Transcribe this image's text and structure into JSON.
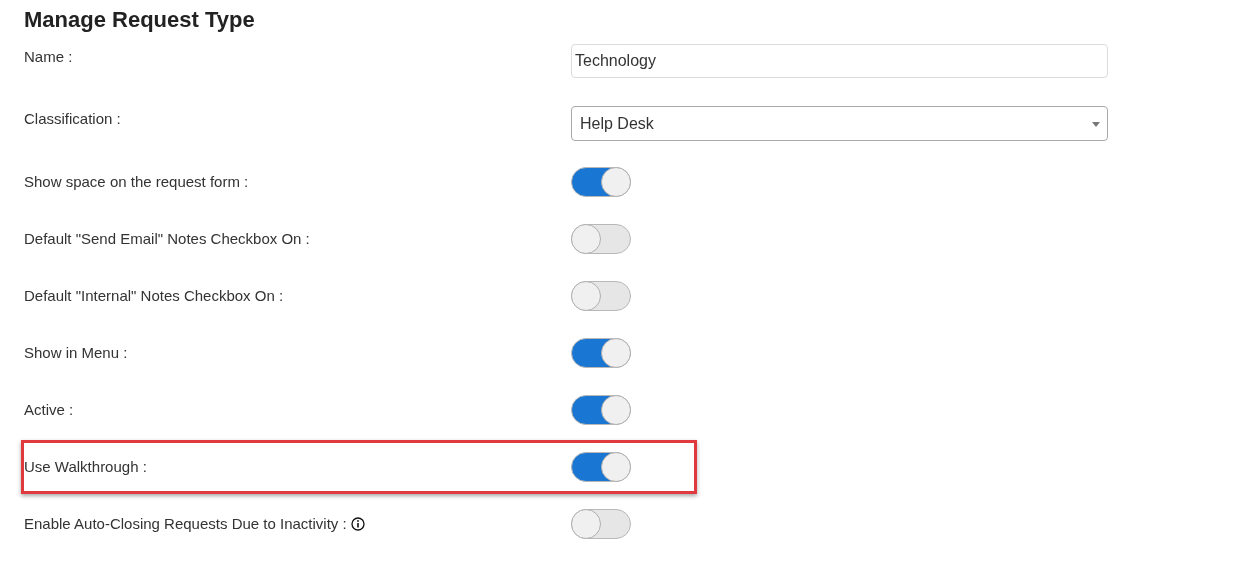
{
  "title": "Manage Request Type",
  "rows": [
    {
      "kind": "text",
      "label": "Name :",
      "value": "Technology"
    },
    {
      "kind": "select",
      "label": "Classification :",
      "value": "Help Desk"
    },
    {
      "kind": "toggle",
      "label": "Show space on the request form :",
      "on": true,
      "highlighted": false
    },
    {
      "kind": "toggle",
      "label": "Default \"Send Email\" Notes Checkbox On :",
      "on": false,
      "highlighted": false
    },
    {
      "kind": "toggle",
      "label": "Default \"Internal\" Notes Checkbox On :",
      "on": false,
      "highlighted": false
    },
    {
      "kind": "toggle",
      "label": "Show in Menu :",
      "on": true,
      "highlighted": false
    },
    {
      "kind": "toggle",
      "label": "Active :",
      "on": true,
      "highlighted": false
    },
    {
      "kind": "toggle",
      "label": "Use Walkthrough :",
      "on": true,
      "highlighted": true
    },
    {
      "kind": "toggle",
      "label": "Enable Auto-Closing Requests Due to Inactivity :",
      "on": false,
      "highlighted": false,
      "info": true
    }
  ]
}
